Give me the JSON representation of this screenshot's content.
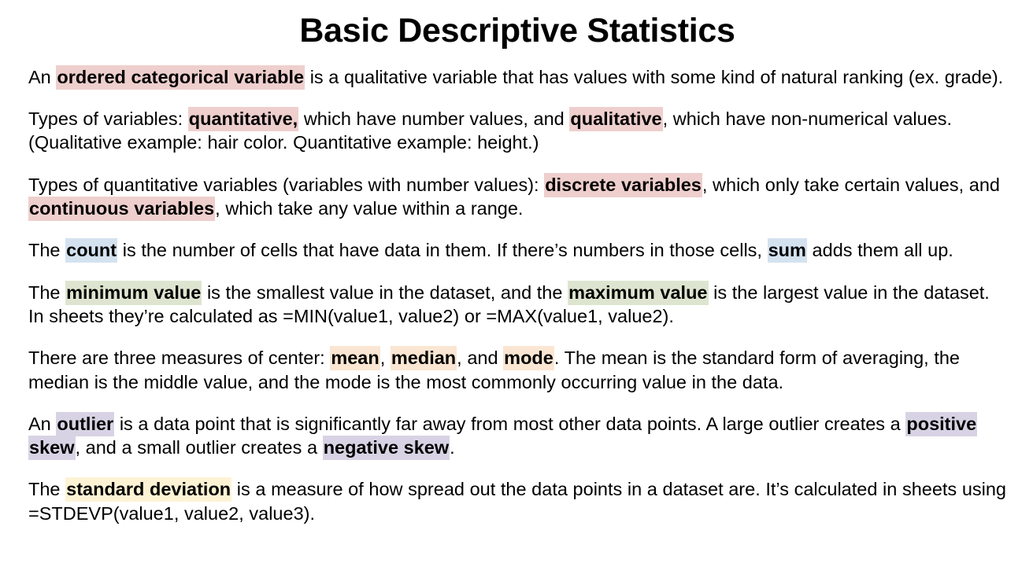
{
  "slide": {
    "title": "Basic Descriptive Statistics",
    "background_color": "#ffffff",
    "text_color": "#000000"
  },
  "highlight_colors": {
    "pink": "#eecfcd",
    "blue": "#d4e2f0",
    "green": "#dde5d0",
    "peach": "#fae6d2",
    "purple": "#d8d3e4",
    "yellow": "#fdf3d4"
  },
  "paragraphs": {
    "p1": {
      "s1": "An ",
      "term1": "ordered categorical variable",
      "s2": " is a qualitative variable that has values with some kind of natural ranking (ex. grade)."
    },
    "p2": {
      "s1": "Types of variables: ",
      "term1": "quantitative,",
      "s2": " which have number values, and ",
      "term2": "qualitative",
      "s3": ", which have non-numerical values. (Qualitative example: hair color. Quantitative example: height.)"
    },
    "p3": {
      "s1": "Types of quantitative variables (variables with number values): ",
      "term1": "discrete variables",
      "s2": ", which only take certain values, and ",
      "term2": "continuous variables",
      "s3": ", which take any value within a range."
    },
    "p4": {
      "s1": "The ",
      "term1": "count",
      "s2": " is the number of cells that have data in them. If there’s numbers in those cells, ",
      "term2": "sum",
      "s3": " adds them all up."
    },
    "p5": {
      "s1": "The ",
      "term1": "minimum value",
      "s2": " is the smallest value in the dataset, and the ",
      "term2": "maximum value",
      "s3": " is the largest value in the dataset. In sheets they’re calculated as =MIN(value1, value2) or =MAX(value1, value2)."
    },
    "p6": {
      "s1": "There are three measures of center: ",
      "term1": "mean",
      "s2": ", ",
      "term2": "median",
      "s3": ", and ",
      "term3": "mode",
      "s4": ". The mean is the standard form of averaging, the median is the middle value, and the mode is the most commonly occurring value in the data."
    },
    "p7": {
      "s1": "An ",
      "term1": "outlier",
      "s2": " is a data point that is significantly far away from most other data points. A large outlier creates a ",
      "term2": "positive skew",
      "s3": ", and a small outlier creates a ",
      "term3": "negative skew",
      "s4": "."
    },
    "p8": {
      "s1": "The ",
      "term1": "standard deviation",
      "s2": " is a measure of how spread out the data points in a dataset are. It’s calculated in sheets using =STDEVP(value1, value2, value3)."
    }
  }
}
